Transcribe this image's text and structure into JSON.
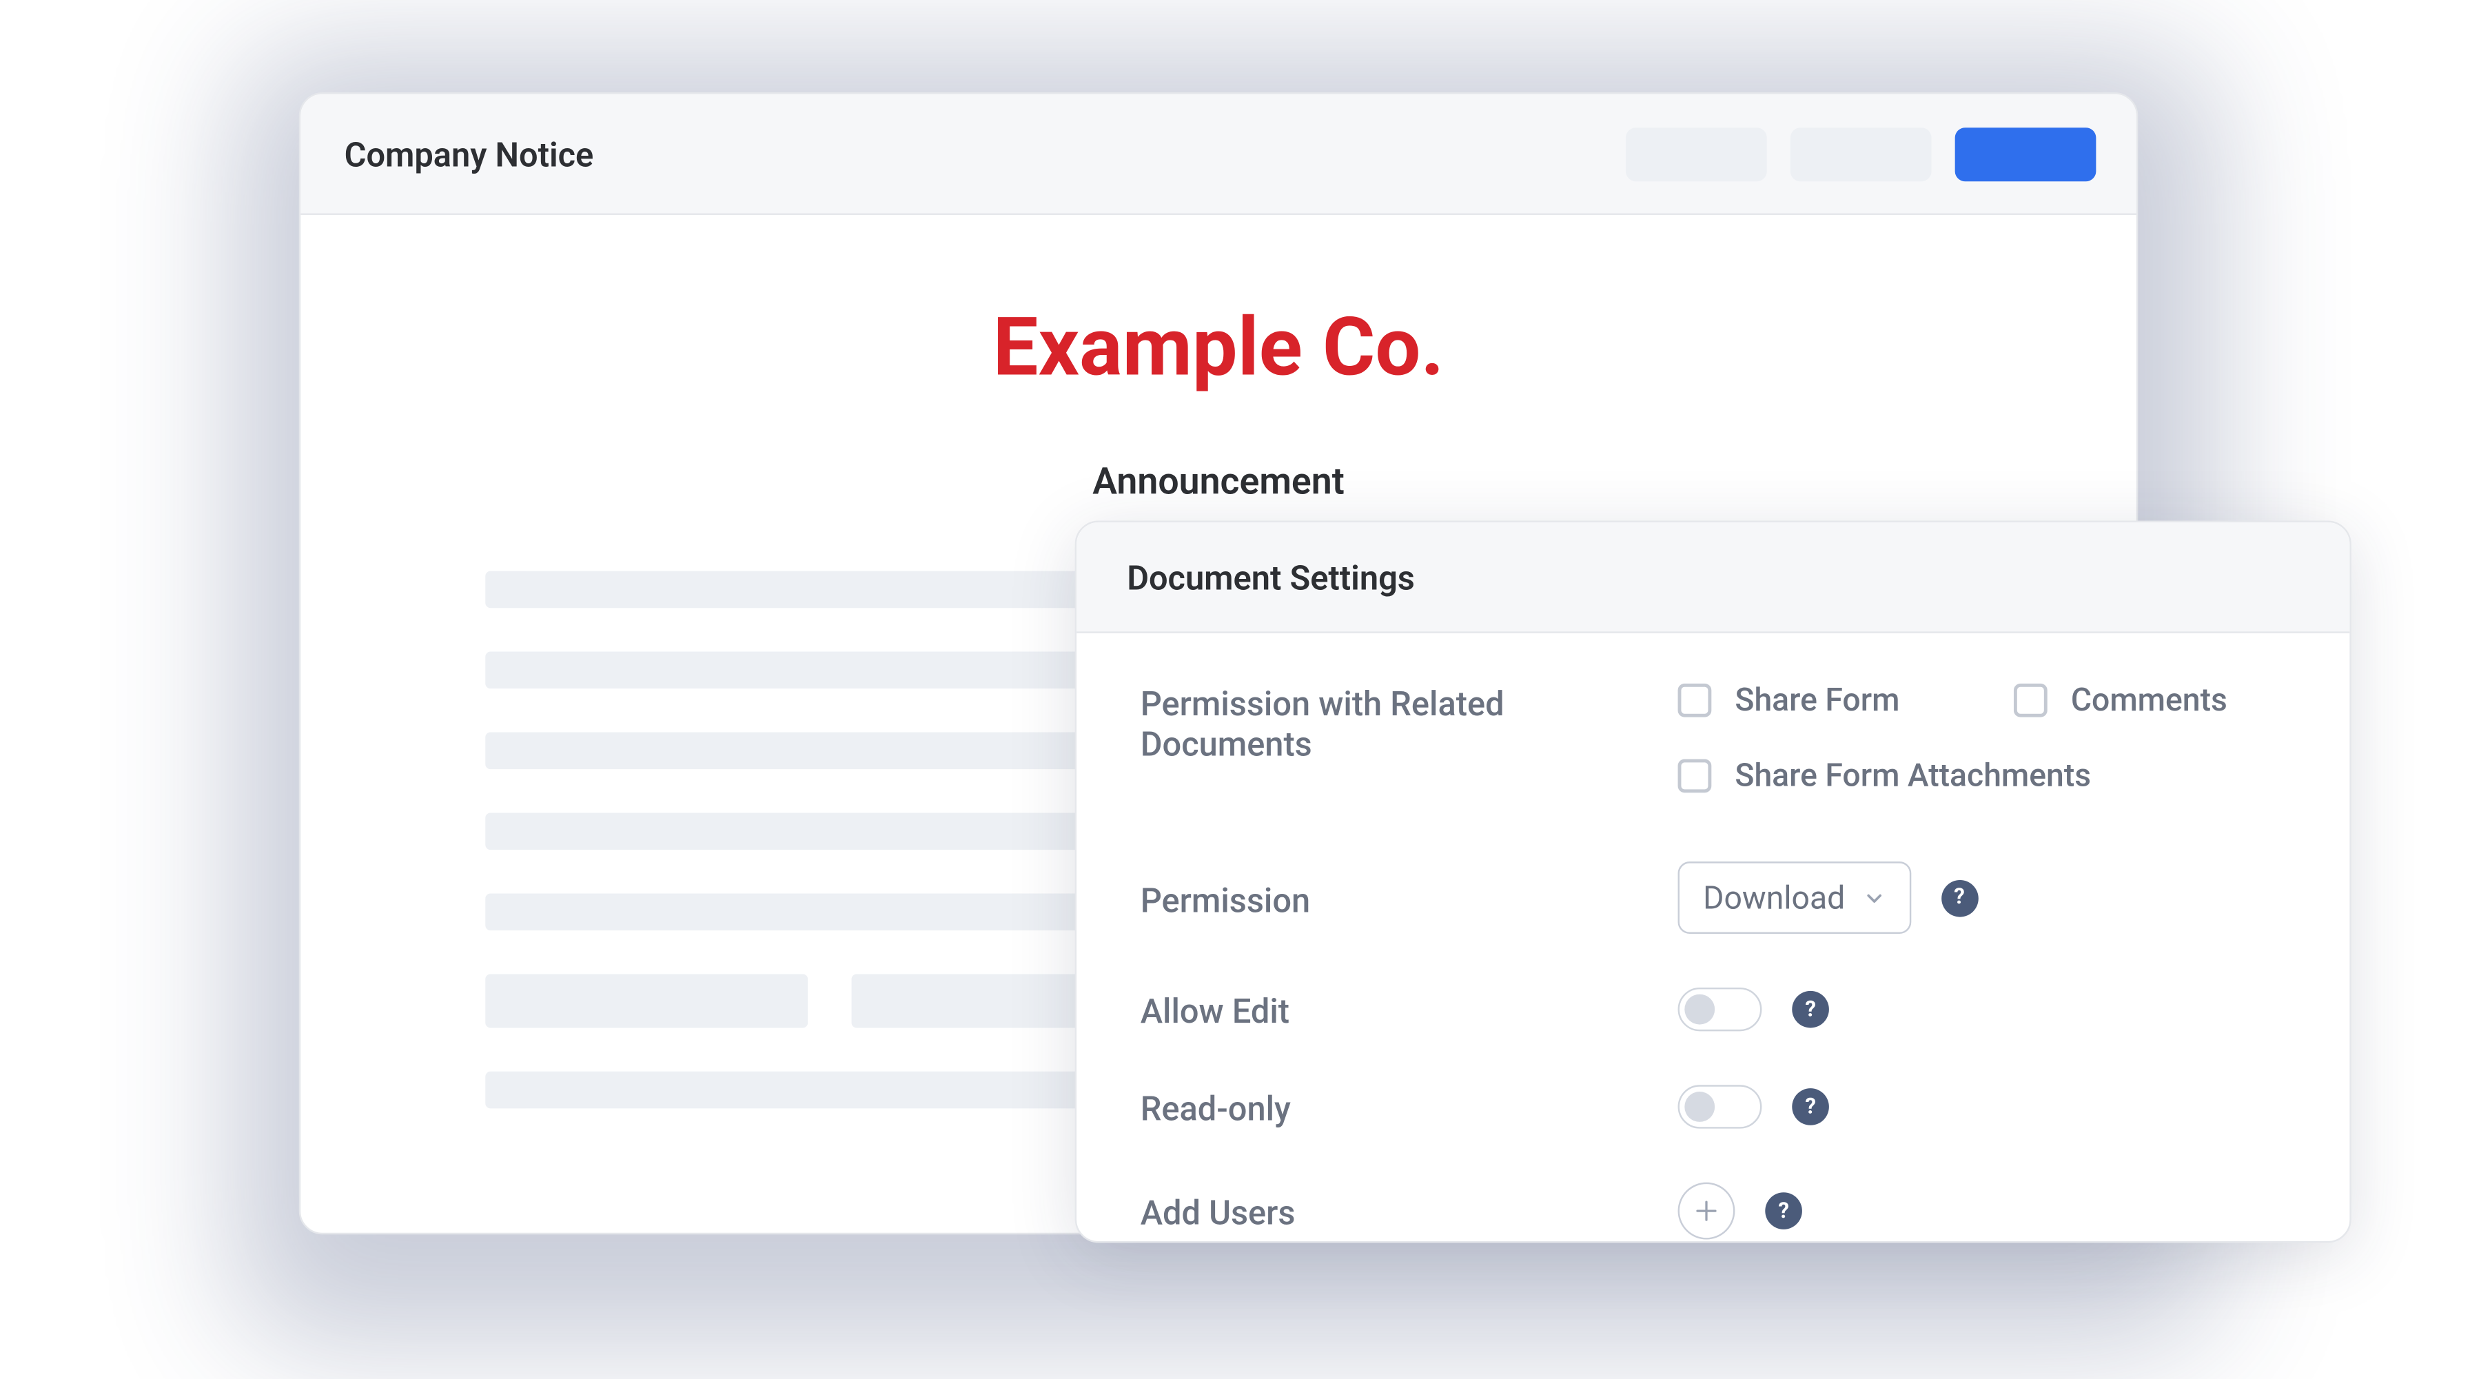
{
  "doc": {
    "header_title": "Company Notice",
    "company_name": "Example Co.",
    "subtitle": "Announcement"
  },
  "settings": {
    "title": "Document Settings",
    "permission_related_label": "Permission with Related Documents",
    "checkboxes": {
      "share_form": "Share Form",
      "comments": "Comments",
      "share_form_attachments": "Share Form Attachments"
    },
    "permission_label": "Permission",
    "permission_value": "Download",
    "allow_edit_label": "Allow Edit",
    "read_only_label": "Read-only",
    "add_users_label": "Add Users"
  }
}
